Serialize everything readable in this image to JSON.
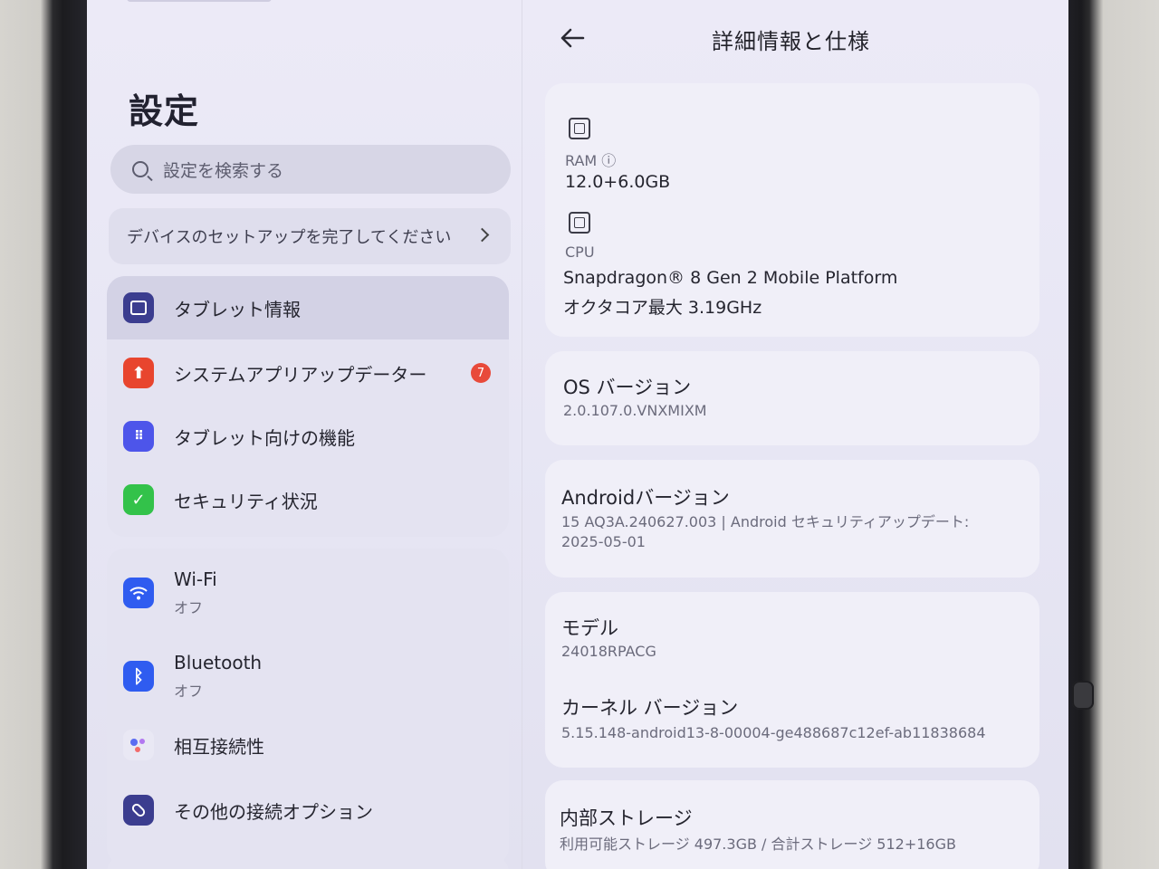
{
  "left": {
    "title": "設定",
    "search_placeholder": "設定を検索する",
    "setup_prompt": "デバイスのセットアップを完了してください",
    "items": [
      {
        "label": "タブレット情報",
        "icon": "tablet-icon",
        "color": "#3b3d8f"
      },
      {
        "label": "システムアプリアップデーター",
        "icon": "upload-arrow-icon",
        "color": "#e8452e",
        "badge": "7"
      },
      {
        "label": "タブレット向けの機能",
        "icon": "grid-dots-icon",
        "color": "#4d55ea"
      },
      {
        "label": "セキュリティ状況",
        "icon": "shield-check-icon",
        "color": "#33c24a"
      }
    ],
    "connectivity": [
      {
        "label": "Wi-Fi",
        "sub": "オフ",
        "icon": "wifi-icon",
        "color": "#2f5cf0"
      },
      {
        "label": "Bluetooth",
        "sub": "オフ",
        "icon": "bluetooth-icon",
        "color": "#2f5cf0"
      },
      {
        "label": "相互接続性",
        "icon": "interconnect-dots-icon"
      },
      {
        "label": "その他の接続オプション",
        "icon": "link-icon",
        "color": "#3b3d8f"
      }
    ]
  },
  "right": {
    "title": "詳細情報と仕様",
    "ram": {
      "label": "RAM ⓘ",
      "value": "12.0+6.0GB"
    },
    "cpu": {
      "label": "CPU",
      "value_line1": "Snapdragon® 8 Gen 2 Mobile Platform",
      "value_line2": "オクタコア最大 3.19GHz"
    },
    "os": {
      "label": "OS バージョン",
      "value": "2.0.107.0.VNXMIXM"
    },
    "android": {
      "label": "Androidバージョン",
      "value_line1": "15 AQ3A.240627.003 | Android セキュリティアップデート:",
      "value_line2": "2025-05-01"
    },
    "model": {
      "label": "モデル",
      "value": "24018RPACG"
    },
    "kernel": {
      "label": "カーネル バージョン",
      "value": "5.15.148-android13-8-00004-ge488687c12ef-ab11838684"
    },
    "storage": {
      "label": "内部ストレージ",
      "value": "利用可能ストレージ  497.3GB / 合計ストレージ  512+16GB"
    }
  }
}
